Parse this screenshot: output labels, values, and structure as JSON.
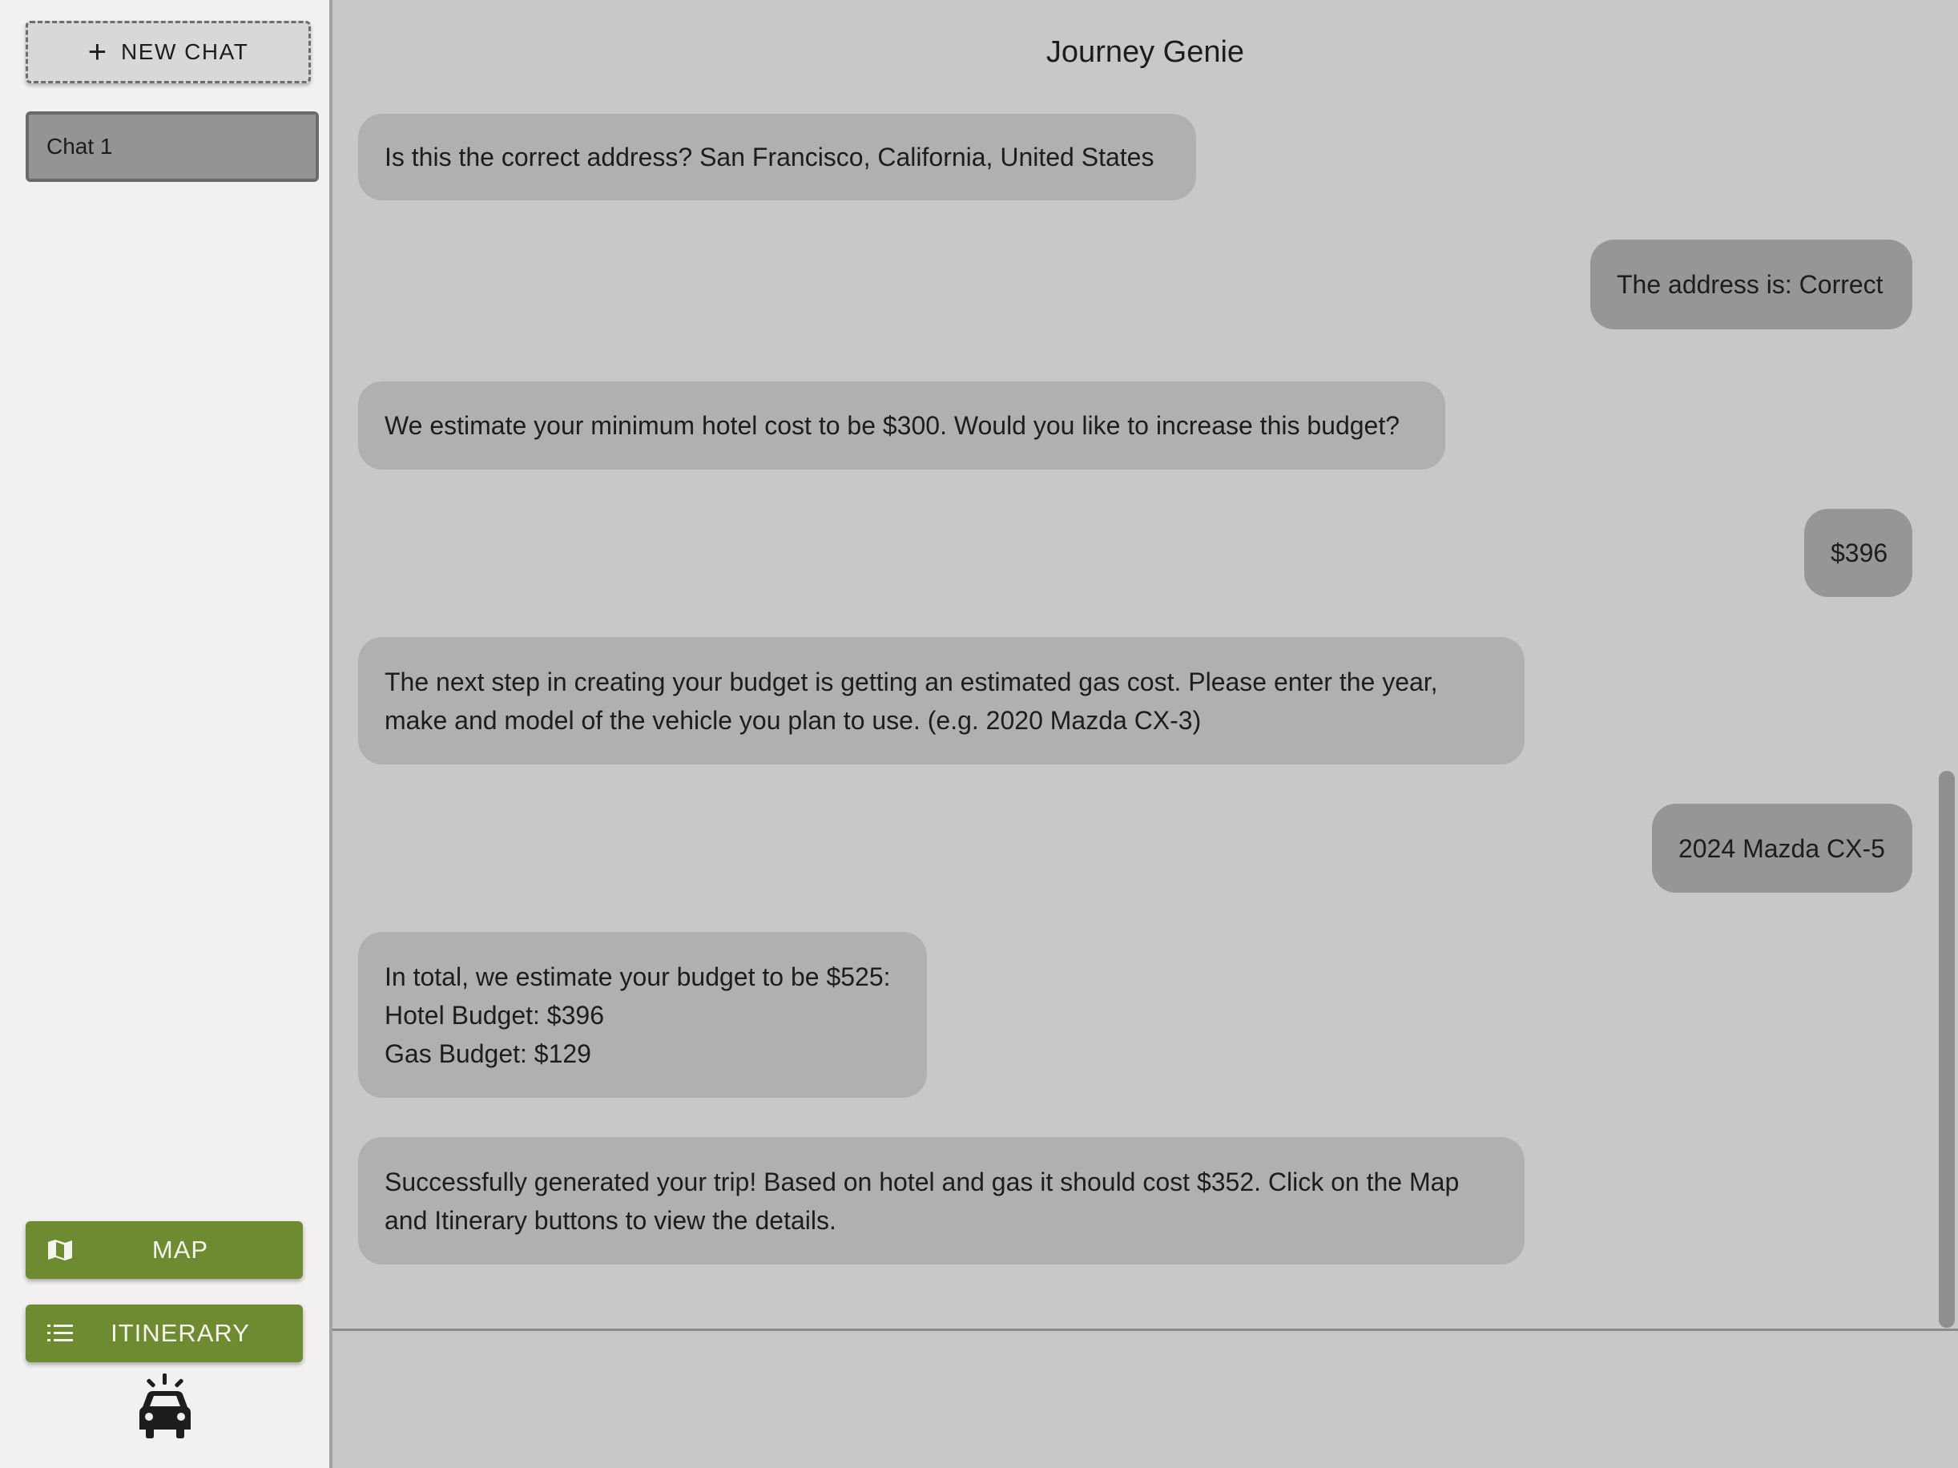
{
  "sidebar": {
    "new_chat_label": "NEW CHAT",
    "chats": [
      {
        "label": "Chat 1"
      }
    ],
    "map_label": "MAP",
    "itinerary_label": "ITINERARY"
  },
  "main": {
    "title": "Journey Genie",
    "messages": [
      {
        "role": "bot",
        "text": "Is this the correct address? San Francisco, California, United States"
      },
      {
        "role": "user",
        "text": "The address is: Correct"
      },
      {
        "role": "bot",
        "text": "We estimate your minimum hotel cost to be $300. Would you like to increase this budget?"
      },
      {
        "role": "user",
        "text": "$396"
      },
      {
        "role": "bot",
        "text": "The next step in creating your budget is getting an estimated gas cost. Please enter the year,\nmake and model of the vehicle you plan to use. (e.g. 2020 Mazda CX-3)"
      },
      {
        "role": "user",
        "text": "2024 Mazda CX-5"
      },
      {
        "role": "bot",
        "text": "In total, we estimate your budget to be $525:\nHotel Budget: $396\nGas Budget: $129"
      },
      {
        "role": "bot",
        "text": "Successfully generated your trip! Based on hotel and gas it should cost $352. Click on the Map\nand Itinerary buttons to view the details."
      }
    ]
  },
  "icons": {
    "new_chat": "plus-icon",
    "map": "map-icon",
    "itinerary": "list-icon",
    "logo": "car-icon"
  },
  "colors": {
    "accent_green": "#6f8b32",
    "sidebar_bg": "#f2f1ef",
    "chat_bg": "#c8c8c6",
    "bot_bubble": "#b0b0ae",
    "user_bubble": "#969694"
  }
}
